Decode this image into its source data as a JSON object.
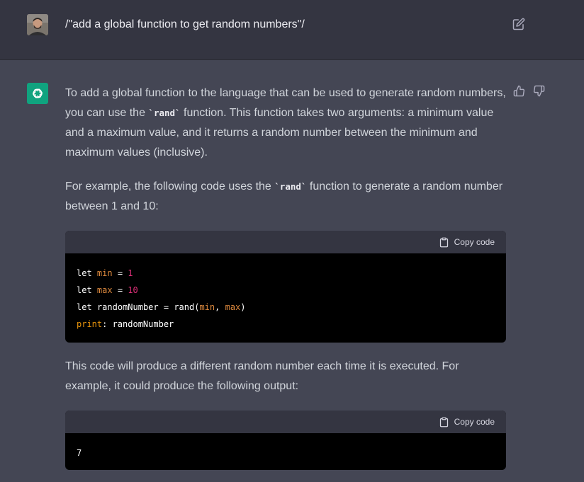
{
  "user": {
    "prompt": "/\"add a global function to get random numbers\"/"
  },
  "assistant": {
    "para1_a": "To add a global function to the language that can be used to generate random numbers, you can use the ",
    "para1_code": "`rand`",
    "para1_b": " function. This function takes two arguments: a minimum value and a maximum value, and it returns a random number between the minimum and maximum values (inclusive).",
    "para2_a": "For example, the following code uses the ",
    "para2_code": "`rand`",
    "para2_b": " function to generate a random number between 1 and 10:",
    "para3": "This code will produce a different random number each time it is executed. For example, it could produce the following output:",
    "copy_label": "Copy code",
    "code1": {
      "line1": {
        "kw": "let",
        "var": "min",
        "op": " = ",
        "num": "1"
      },
      "line2": {
        "kw": "let",
        "var": "max",
        "op": " = ",
        "num": "10"
      },
      "line3": {
        "kw": "let",
        "name": "randomNumber",
        "op": " = ",
        "fn": "rand",
        "open": "(",
        "arg1": "min",
        "sep": ", ",
        "arg2": "max",
        "close": ")"
      },
      "line4": {
        "prop": "print",
        "colon": ": ",
        "name": "randomNumber"
      }
    },
    "code2": {
      "output": "7"
    }
  },
  "colors": {
    "user_bg": "#343541",
    "assistant_bg": "#444654",
    "brand_green": "#10a37f",
    "code_bg": "#000000",
    "code_header_bg": "#343541",
    "var_color": "#df8a3e",
    "num_color": "#df3079"
  },
  "icons": {
    "edit": "pencil-square-icon",
    "thumb_up": "thumbs-up-icon",
    "thumb_down": "thumbs-down-icon",
    "copy": "clipboard-icon",
    "logo": "openai-logo-icon"
  }
}
